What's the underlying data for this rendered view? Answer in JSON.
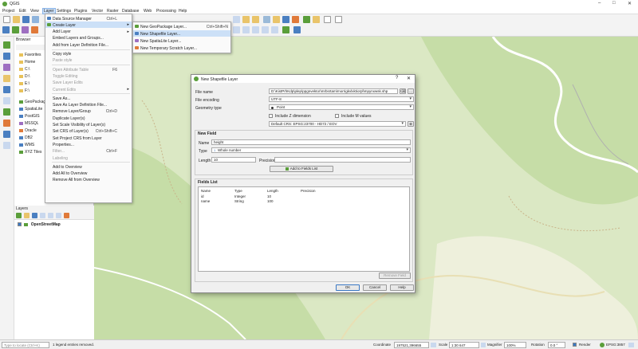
{
  "app": {
    "title": "QGIS",
    "window_controls": [
      "–",
      "□",
      "✕"
    ]
  },
  "menubar": [
    "Project",
    "Edit",
    "View",
    "Layer",
    "Settings",
    "Plugins",
    "Vector",
    "Raster",
    "Database",
    "Web",
    "Processing",
    "Help"
  ],
  "layer_menu": {
    "items": [
      {
        "label": "Data Source Manager",
        "shortcut": "Ctrl+L",
        "icon": "data-source-icon",
        "disabled": false
      },
      {
        "label": "Create Layer",
        "shortcut": "",
        "icon": "create-layer-icon",
        "disabled": false,
        "submenu": true,
        "highlighted": true
      },
      {
        "label": "Add Layer",
        "shortcut": "",
        "icon": "",
        "disabled": false,
        "submenu": true
      },
      {
        "label": "Embed Layers and Groups...",
        "shortcut": "",
        "icon": "",
        "disabled": false
      },
      {
        "label": "Add from Layer Definition File...",
        "shortcut": "",
        "icon": "",
        "disabled": false
      },
      {
        "sep": true
      },
      {
        "label": "Copy style",
        "shortcut": "",
        "icon": "",
        "disabled": false
      },
      {
        "label": "Paste style",
        "shortcut": "",
        "icon": "",
        "disabled": true
      },
      {
        "sep": true
      },
      {
        "label": "Open Attribute Table",
        "shortcut": "F6",
        "icon": "",
        "disabled": true
      },
      {
        "label": "Toggle Editing",
        "shortcut": "",
        "icon": "",
        "disabled": true
      },
      {
        "label": "Save Layer Edits",
        "shortcut": "",
        "icon": "",
        "disabled": true
      },
      {
        "label": "Current Edits",
        "shortcut": "",
        "icon": "",
        "disabled": true,
        "submenu": true
      },
      {
        "sep": true
      },
      {
        "label": "Save As...",
        "shortcut": "",
        "icon": "",
        "disabled": false
      },
      {
        "label": "Save As Layer Definition File...",
        "shortcut": "",
        "icon": "",
        "disabled": false
      },
      {
        "label": "Remove Layer/Group",
        "shortcut": "Ctrl+D",
        "icon": "",
        "disabled": false
      },
      {
        "label": "Duplicate Layer(s)",
        "shortcut": "",
        "icon": "",
        "disabled": false
      },
      {
        "label": "Set Scale Visibility of Layer(s)",
        "shortcut": "",
        "icon": "",
        "disabled": false
      },
      {
        "label": "Set CRS of Layer(s)",
        "shortcut": "Ctrl+Shift+C",
        "icon": "",
        "disabled": false
      },
      {
        "label": "Set Project CRS from Layer",
        "shortcut": "",
        "icon": "",
        "disabled": false
      },
      {
        "label": "Properties...",
        "shortcut": "",
        "icon": "",
        "disabled": false
      },
      {
        "label": "Filter...",
        "shortcut": "Ctrl+F",
        "icon": "",
        "disabled": true
      },
      {
        "label": "Labeling",
        "shortcut": "",
        "icon": "",
        "disabled": true
      },
      {
        "sep": true
      },
      {
        "label": "Add to Overview",
        "shortcut": "",
        "icon": "",
        "disabled": false
      },
      {
        "label": "Add All to Overview",
        "shortcut": "",
        "icon": "",
        "disabled": false
      },
      {
        "label": "Remove All from Overview",
        "shortcut": "",
        "icon": "",
        "disabled": false
      }
    ]
  },
  "create_layer_submenu": [
    {
      "label": "New GeoPackage Layer...",
      "shortcut": "Ctrl+Shift+N",
      "highlighted": false
    },
    {
      "label": "New Shapefile Layer...",
      "shortcut": "",
      "highlighted": true
    },
    {
      "label": "New SpatiaLite Layer...",
      "shortcut": "",
      "highlighted": false
    },
    {
      "label": "New Temporary Scratch Layer...",
      "shortcut": "",
      "highlighted": false
    }
  ],
  "browser": {
    "title": "Browser",
    "items": [
      "Favorites",
      "Home",
      "C:\\",
      "D:\\",
      "E:\\",
      "F:\\",
      "GeoPackage",
      "SpatiaLite",
      "PostGIS",
      "MSSQL",
      "Oracle",
      "DB2",
      "WMS",
      "XYZ Tiles"
    ]
  },
  "layers": {
    "title": "Layers",
    "items": [
      {
        "name": "OpenStreetMap",
        "checked": true
      }
    ]
  },
  "dialog": {
    "title": "New Shapefile Layer",
    "file_name_label": "File name",
    "file_name_value": "D:\\KistPrhKdp\\plep\\ppgnvektor\\mrbsrtam\\morrigkvlxktiorpl\\mpynxwsk.shp",
    "encoding_label": "File encoding",
    "encoding_value": "UTF-8",
    "geometry_label": "Geometry type",
    "geometry_value": "Point",
    "include_z": "Include Z dimension",
    "include_m": "Include M values",
    "crs_value": "Default CRS: EPSG:23700 - HD72 / EOV",
    "new_field_title": "New Field",
    "name_label": "Name",
    "name_value": "height",
    "type_label": "Type",
    "type_value": "Whole number",
    "length_label": "Length",
    "length_value": "10",
    "precision_label": "Precision",
    "precision_value": "",
    "add_field_button": "Add to Fields List",
    "fields_list_title": "Fields List",
    "fields_columns": [
      "Name",
      "Type",
      "Length",
      "Precision"
    ],
    "fields_rows": [
      [
        "id",
        "Integer",
        "10",
        ""
      ],
      [
        "name",
        "String",
        "100",
        ""
      ]
    ],
    "remove_field_button": "Remove Field",
    "ok_button": "OK",
    "cancel_button": "Cancel",
    "help_button": "Help"
  },
  "status": {
    "search_placeholder": "Type to locate (Ctrl+K)",
    "message": "1 legend entries removed.",
    "coordinate_label": "Coordinate",
    "coordinate_value": "197521,396655",
    "scale_label": "Scale",
    "scale_value": "1:30 647",
    "magnifier_label": "Magnifier",
    "magnifier_value": "100%",
    "rotation_label": "Rotation",
    "rotation_value": "0.0 °",
    "render_label": "Render",
    "crs": "EPSG:3857"
  },
  "colors": {
    "map_bg": "#dbe8c4",
    "forest": "#b9d49a",
    "river": "#ffffff",
    "highlight": "#cce0f7"
  }
}
